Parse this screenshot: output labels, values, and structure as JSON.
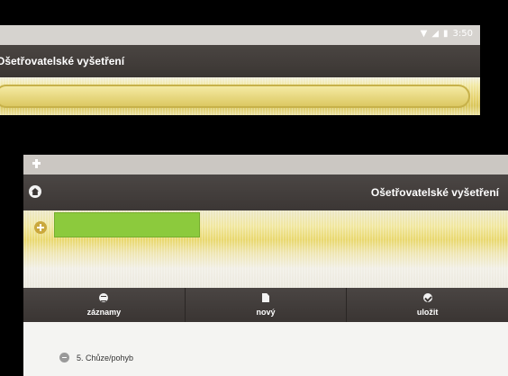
{
  "top_screen": {
    "status_time": "3:50",
    "title": "Ošetřovatelské vyšetření"
  },
  "bottom_screen": {
    "title": "Ošetřovatelské vyšetření",
    "actions": [
      {
        "label": "záznamy",
        "icon": "list-icon"
      },
      {
        "label": "nový",
        "icon": "document-icon"
      },
      {
        "label": "uložit",
        "icon": "check-icon"
      }
    ],
    "section": {
      "label": "5. Chůze/pohyb"
    }
  },
  "colors": {
    "titlebar": "#3c3735",
    "highlight_yellow": "#e9d86f",
    "green_field": "#8cca3d"
  }
}
